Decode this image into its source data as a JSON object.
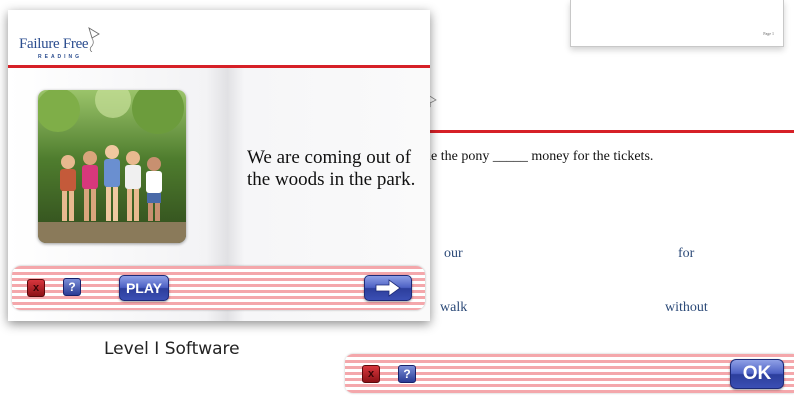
{
  "top_card": {
    "page_label": "Page 1"
  },
  "lesson_window": {
    "brand": "Failure Free",
    "brand_sub": "READING",
    "reading_text_line1": "We are coming out of",
    "reading_text_line2": "the woods in the park.",
    "toolbar": {
      "exit_label": "x",
      "help_label": "?",
      "play_label": "PLAY",
      "next_icon": "arrow-right-icon"
    }
  },
  "caption": "Level I Software",
  "quiz_window": {
    "sentence": "de the pony _____ money for the tickets.",
    "choices": [
      "our",
      "for",
      "walk",
      "without"
    ],
    "toolbar": {
      "exit_label": "x",
      "help_label": "?",
      "ok_label": "OK"
    }
  },
  "colors": {
    "accent_red": "#d62027",
    "button_blue": "#3b4fb4",
    "brand_blue": "#2b4d8f"
  }
}
